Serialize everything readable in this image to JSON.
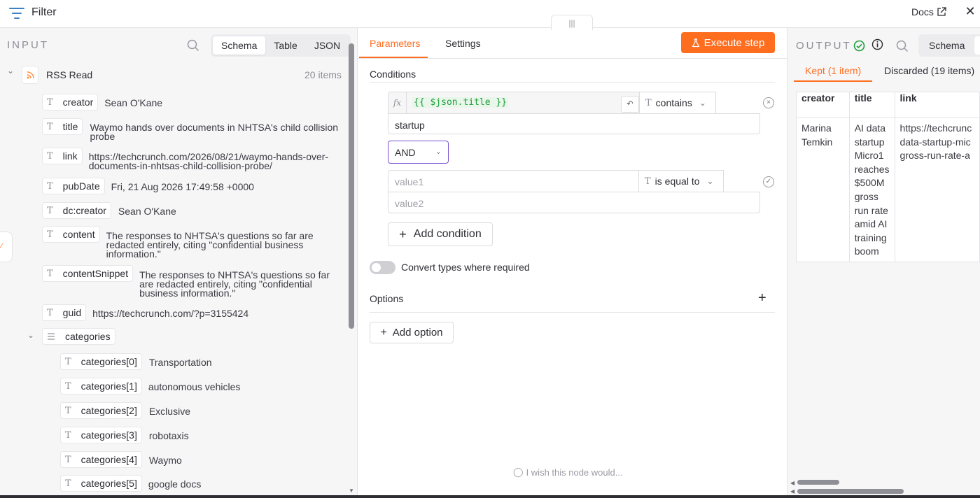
{
  "header": {
    "title": "Filter",
    "docs_label": "Docs",
    "close_label": "✕",
    "drag_handle": "|||"
  },
  "input": {
    "label": "INPUT",
    "view_tabs": [
      "Schema",
      "Table",
      "JSON"
    ],
    "active_view": "Schema",
    "node_name": "RSS Read",
    "item_count": "20 items",
    "fields": [
      {
        "key": "creator",
        "value": "Sean O'Kane"
      },
      {
        "key": "title",
        "value_lines": [
          "Waymo hands over documents in NHTSA's child collision",
          "probe"
        ]
      },
      {
        "key": "link",
        "value_lines": [
          "https://techcrunch.com/2026/08/21/waymo-hands-over-",
          "documents-in-nhtsas-child-collision-probe/"
        ]
      },
      {
        "key": "pubDate",
        "value": "Fri, 21 Aug 2026 17:49:58 +0000"
      },
      {
        "key": "dc:creator",
        "value": "Sean O'Kane"
      },
      {
        "key": "content",
        "value_lines": [
          "The responses to NHTSA's questions so far are",
          "redacted entirely, citing \"confidential business",
          "information.\""
        ]
      },
      {
        "key": "contentSnippet",
        "value_lines": [
          "The responses to NHTSA's questions so far",
          "are redacted entirely, citing \"confidential",
          "business information.\""
        ]
      },
      {
        "key": "guid",
        "value": "https://techcrunch.com/?p=3155424"
      }
    ],
    "categories_label": "categories",
    "categories": [
      {
        "key": "categories[0]",
        "value": "Transportation"
      },
      {
        "key": "categories[1]",
        "value": "autonomous vehicles"
      },
      {
        "key": "categories[2]",
        "value": "Exclusive"
      },
      {
        "key": "categories[3]",
        "value": "robotaxis"
      },
      {
        "key": "categories[4]",
        "value": "Waymo"
      },
      {
        "key": "categories[5]",
        "value": "google docs"
      }
    ]
  },
  "params": {
    "tabs": [
      "Parameters",
      "Settings"
    ],
    "active_tab": "Parameters",
    "execute_label": "Execute step",
    "conditions_label": "Conditions",
    "condition1": {
      "expression": "{{ $json.title }}",
      "operator": "contains",
      "value": "startup"
    },
    "combinator": "AND",
    "condition2": {
      "value1_placeholder": "value1",
      "operator": "is equal to",
      "value2_placeholder": "value2"
    },
    "add_condition_label": "Add condition",
    "convert_types_label": "Convert types where required",
    "convert_types_on": false,
    "options_label": "Options",
    "add_option_label": "Add option",
    "feedback_label": "I wish this node would..."
  },
  "output": {
    "label": "OUTPUT",
    "view_label": "Schema",
    "tabs": [
      "Kept (1 item)",
      "Discarded (19 items)"
    ],
    "active_tab": "Kept (1 item)",
    "columns": [
      "creator",
      "title",
      "link"
    ],
    "row": {
      "creator_lines": [
        "Marina",
        "Temkin"
      ],
      "title_lines": [
        "AI data",
        "startup",
        "Micro1",
        "reaches",
        "$500M",
        "gross",
        "run rate",
        "amid AI",
        "training",
        "boom"
      ],
      "link_lines": [
        "https://techcrunc",
        "data-startup-mic",
        "gross-run-rate-a"
      ]
    }
  },
  "colors": {
    "accent": "#ff6d1f",
    "success": "#1f9d3b",
    "and_border": "#7a4fd1"
  },
  "icons": [
    "filter-icon",
    "external-link-icon",
    "close-icon",
    "search-icon",
    "rss-icon",
    "text-type-icon",
    "list-icon",
    "flask-icon",
    "fx-icon",
    "reset-icon",
    "remove-icon",
    "plus-icon",
    "lightbulb-icon",
    "check-circle-icon",
    "info-icon"
  ]
}
